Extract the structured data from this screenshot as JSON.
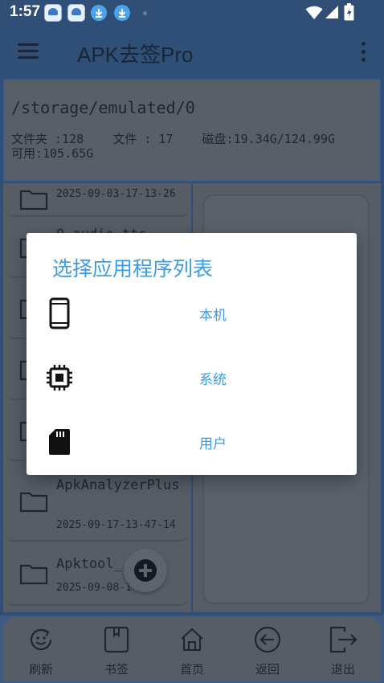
{
  "status_bar": {
    "time": "1:57",
    "icons": [
      "app-store-icon",
      "app-store-icon",
      "download-icon",
      "download-icon",
      "dot-icon",
      "wifi-icon",
      "signal-icon",
      "battery-icon"
    ]
  },
  "app_bar": {
    "title": "APK去签Pro",
    "menu_icon": "hamburger-menu-icon",
    "more_icon": "more-vert-icon"
  },
  "path_panel": {
    "path": "/storage/emulated/0",
    "stats_line1": "文件夹 :128    文件 : 17    磁盘:19.34G/124.99G",
    "stats_line2": "可用:105.65G"
  },
  "file_list": {
    "items": [
      {
        "name": "",
        "date": "2025-09-03-17-13-26"
      },
      {
        "name": "0.audio.tts",
        "date": ""
      },
      {
        "name": "",
        "date": ""
      },
      {
        "name": "",
        "date": ""
      },
      {
        "name": "",
        "date": ""
      },
      {
        "name": "ApkAnalyzerPlus",
        "date": "2025-09-17-13-47-14"
      },
      {
        "name": "Apktool_",
        "date": "2025-09-08-1 -45"
      }
    ]
  },
  "fab": {
    "icon": "add-circle-icon"
  },
  "bottom_nav": {
    "items": [
      {
        "label": "刷新",
        "icon": "refresh-icon"
      },
      {
        "label": "书签",
        "icon": "bookmark-icon"
      },
      {
        "label": "首页",
        "icon": "home-icon"
      },
      {
        "label": "返回",
        "icon": "back-arrow-icon"
      },
      {
        "label": "退出",
        "icon": "exit-icon"
      }
    ]
  },
  "dialog": {
    "title": "选择应用程序列表",
    "options": [
      {
        "label": "本机",
        "icon": "phone-icon"
      },
      {
        "label": "系统",
        "icon": "chip-icon"
      },
      {
        "label": "用户",
        "icon": "sd-card-icon"
      }
    ]
  },
  "colors": {
    "accent": "#3b9be3",
    "appbar_dim": "#2f4f76",
    "panel_dim": "#565d66",
    "dialog_bg": "#ffffff"
  }
}
